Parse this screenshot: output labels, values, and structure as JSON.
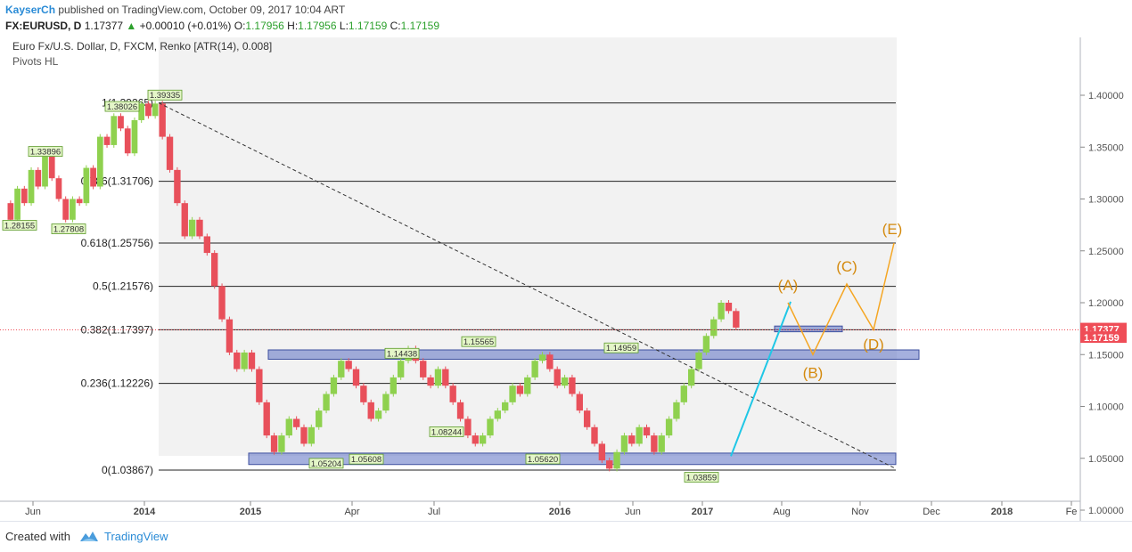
{
  "header": {
    "author": "KayserCh",
    "published_text": "published on TradingView.com, October 09, 2017 10:04 ART",
    "symbol": "FX:EURUSD, D",
    "last": "1.17377",
    "change_arrow": "▲",
    "change": "+0.00010 (+0.01%)",
    "o_label": "O:",
    "o": "1.17956",
    "h_label": "H:",
    "h": "1.17956",
    "l_label": "L:",
    "l": "1.17159",
    "c_label": "C:",
    "c": "1.17159"
  },
  "legend": {
    "main": "Euro Fx/U.S. Dollar, D, FXCM, Renko [ATR(14), 0.008]",
    "indicator": "Pivots HL"
  },
  "footer": {
    "created": "Created with",
    "brand": "TradingView"
  },
  "colors": {
    "up": "#8fd14f",
    "down": "#e8505b",
    "accent": "#2a8bd6",
    "wave": "#f5a623",
    "zone": "#5b6fc2",
    "price_tag": "#ef4d57"
  },
  "chart_data": {
    "type": "renko",
    "ylim": [
      0.995,
      1.425
    ],
    "y_ticks": [
      "1.00000",
      "1.05000",
      "1.10000",
      "1.15000",
      "1.20000",
      "1.25000",
      "1.30000",
      "1.35000",
      "1.40000"
    ],
    "y_tick_values": [
      1.0,
      1.05,
      1.1,
      1.15,
      1.2,
      1.25,
      1.3,
      1.35,
      1.4
    ],
    "x_tick_labels": [
      "Jun",
      "2014",
      "2015",
      "Apr",
      "Jul",
      "2016",
      "Jun",
      "2017",
      "Aug",
      "Nov",
      "Dec",
      "2018",
      "Fe"
    ],
    "fib_levels": [
      {
        "label": "1(1.39265)",
        "value": 1.39265
      },
      {
        "label": "0.786(1.31706)",
        "value": 1.31706
      },
      {
        "label": "0.618(1.25756)",
        "value": 1.25756
      },
      {
        "label": "0.5(1.21576)",
        "value": 1.21576
      },
      {
        "label": "0.382(1.17397)",
        "value": 1.17397
      },
      {
        "label": "0.236(1.12226)",
        "value": 1.12226
      },
      {
        "label": "0(1.03867)",
        "value": 1.03867
      }
    ],
    "pivots": [
      {
        "label": "1.39335",
        "value": 1.39335,
        "kind": "high"
      },
      {
        "label": "1.38026",
        "value": 1.38026,
        "kind": "high"
      },
      {
        "label": "1.33896",
        "value": 1.33896,
        "kind": "high"
      },
      {
        "label": "1.28155",
        "value": 1.28155,
        "kind": "low"
      },
      {
        "label": "1.27808",
        "value": 1.27808,
        "kind": "low"
      },
      {
        "label": "1.14438",
        "value": 1.14438,
        "kind": "high"
      },
      {
        "label": "1.15565",
        "value": 1.15565,
        "kind": "high"
      },
      {
        "label": "1.14959",
        "value": 1.14959,
        "kind": "high"
      },
      {
        "label": "1.08244",
        "value": 1.08244,
        "kind": "low"
      },
      {
        "label": "1.05204",
        "value": 1.05204,
        "kind": "low"
      },
      {
        "label": "1.05608",
        "value": 1.05608,
        "kind": "low"
      },
      {
        "label": "1.05620",
        "value": 1.0562,
        "kind": "low"
      },
      {
        "label": "1.03859",
        "value": 1.03859,
        "kind": "low"
      }
    ],
    "zones": [
      {
        "low": 1.1455,
        "high": 1.1545
      },
      {
        "low": 1.044,
        "high": 1.055
      },
      {
        "low": 1.172,
        "high": 1.1775
      }
    ],
    "waves": [
      {
        "label": "(A)",
        "value": 1.2
      },
      {
        "label": "(B)",
        "value": 1.15
      },
      {
        "label": "(C)",
        "value": 1.218
      },
      {
        "label": "(D)",
        "value": 1.174
      },
      {
        "label": "(E)",
        "value": 1.2575
      }
    ],
    "price_tags": [
      {
        "label": "1.17377",
        "value": 1.17377
      },
      {
        "label": "1.17159",
        "value": 1.17159
      }
    ],
    "renko_path": [
      [
        1.296,
        1.28,
        1.31,
        1.296,
        1.328,
        1.312,
        1.344,
        1.32,
        1.3,
        1.28,
        1.3,
        1.296,
        1.33,
        1.312,
        1.36,
        1.352,
        1.38,
        1.368,
        1.344,
        1.376,
        1.392,
        1.38,
        1.392
      ],
      [
        1.392,
        1.36,
        1.328,
        1.296,
        1.264,
        1.28,
        1.264,
        1.248,
        1.216,
        1.184,
        1.152,
        1.136,
        1.152,
        1.136,
        1.104,
        1.072,
        1.056,
        1.072,
        1.088,
        1.08,
        1.064,
        1.08,
        1.096,
        1.112,
        1.128,
        1.144,
        1.136,
        1.12,
        1.104,
        1.088,
        1.096,
        1.112,
        1.128,
        1.144,
        1.156,
        1.144,
        1.128,
        1.12,
        1.136,
        1.12,
        1.104,
        1.088,
        1.072,
        1.064,
        1.072,
        1.088,
        1.096,
        1.104,
        1.12,
        1.112,
        1.128,
        1.144,
        1.15,
        1.136,
        1.12,
        1.128,
        1.112,
        1.096,
        1.08,
        1.064,
        1.048,
        1.04,
        1.056,
        1.072,
        1.064,
        1.08,
        1.072,
        1.056,
        1.072,
        1.088,
        1.104,
        1.12,
        1.136,
        1.152,
        1.168,
        1.184,
        1.2,
        1.192,
        1.176
      ]
    ]
  }
}
